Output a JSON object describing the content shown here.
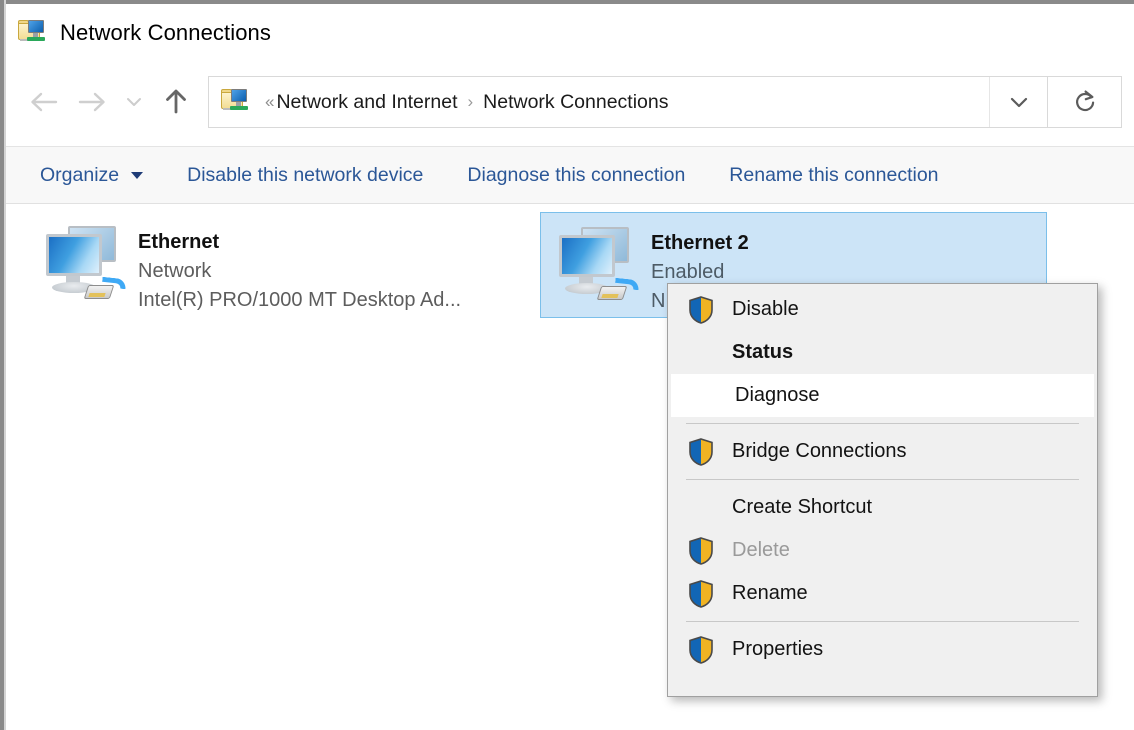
{
  "window": {
    "title": "Network Connections",
    "title_icon": "network-folder-icon"
  },
  "navigation": {
    "back_icon": "arrow-left-icon",
    "forward_icon": "arrow-right-icon",
    "recent_icon": "chevron-down-icon",
    "up_icon": "arrow-up-icon",
    "back_enabled": "false",
    "forward_enabled": "false",
    "up_enabled": "true"
  },
  "address_bar": {
    "icon": "network-folder-icon",
    "overflow": "«",
    "separator": "›",
    "crumbs": [
      {
        "label": "Network and Internet"
      },
      {
        "label": "Network Connections"
      }
    ],
    "dropdown_icon": "chevron-down-icon",
    "refresh_icon": "refresh-icon"
  },
  "toolbar": {
    "items": [
      {
        "label": "Organize",
        "has_caret": "true"
      },
      {
        "label": "Disable this network device",
        "has_caret": "false"
      },
      {
        "label": "Diagnose this connection",
        "has_caret": "false"
      },
      {
        "label": "Rename this connection",
        "has_caret": "false"
      }
    ],
    "accent_color": "#2b5797"
  },
  "connections": [
    {
      "name": "Ethernet",
      "status": "Network",
      "adapter": "Intel(R) PRO/1000 MT Desktop Ad...",
      "icon": "network-adapter-icon",
      "selected": "false"
    },
    {
      "name": "Ethernet 2",
      "status": "Enabled",
      "adapter": "N",
      "icon": "network-adapter-icon",
      "selected": "true"
    }
  ],
  "selection_color": "#cce4f7",
  "context_menu": {
    "items": [
      {
        "label": "Disable",
        "icon": "uac-shield-icon",
        "bold": "false",
        "disabled": "false",
        "highlighted": "false",
        "separator_after": "false"
      },
      {
        "label": "Status",
        "icon": "",
        "bold": "true",
        "disabled": "false",
        "highlighted": "false",
        "separator_after": "false"
      },
      {
        "label": "Diagnose",
        "icon": "",
        "bold": "false",
        "disabled": "false",
        "highlighted": "true",
        "separator_after": "true"
      },
      {
        "label": "Bridge Connections",
        "icon": "uac-shield-icon",
        "bold": "false",
        "disabled": "false",
        "highlighted": "false",
        "separator_after": "true"
      },
      {
        "label": "Create Shortcut",
        "icon": "",
        "bold": "false",
        "disabled": "false",
        "highlighted": "false",
        "separator_after": "false"
      },
      {
        "label": "Delete",
        "icon": "uac-shield-icon",
        "bold": "false",
        "disabled": "true",
        "highlighted": "false",
        "separator_after": "false"
      },
      {
        "label": "Rename",
        "icon": "uac-shield-icon",
        "bold": "false",
        "disabled": "false",
        "highlighted": "false",
        "separator_after": "true"
      },
      {
        "label": "Properties",
        "icon": "uac-shield-icon",
        "bold": "false",
        "disabled": "false",
        "highlighted": "false",
        "separator_after": "false"
      }
    ]
  }
}
